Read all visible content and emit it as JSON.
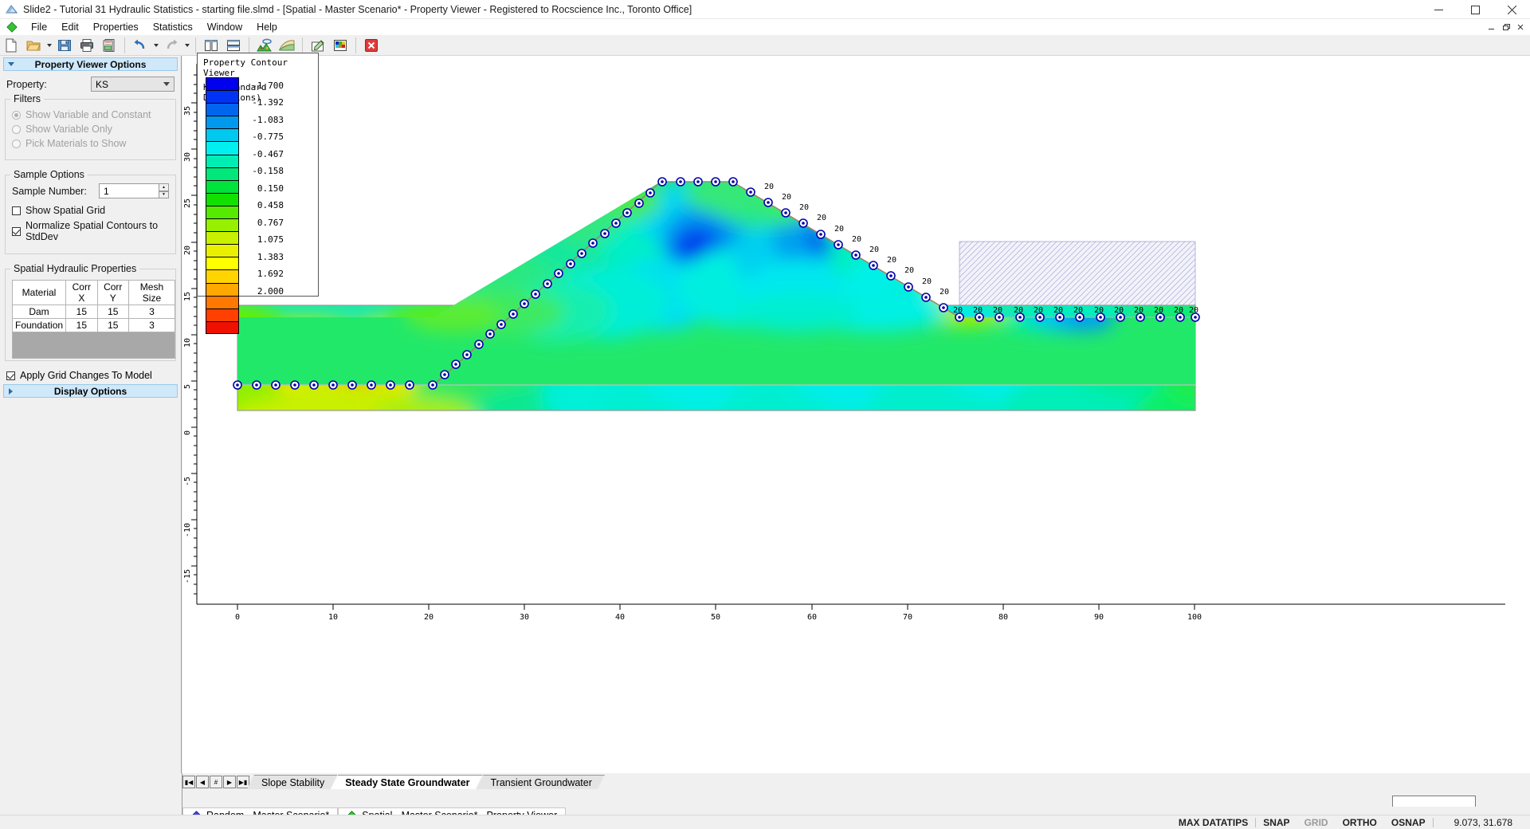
{
  "window": {
    "title": "Slide2 - Tutorial 31 Hydraulic Statistics - starting file.slmd - [Spatial - Master Scenario* - Property Viewer - Registered to Rocscience Inc., Toronto Office]",
    "minimize": "minimize-button",
    "maximize": "maximize-button",
    "close": "close-button"
  },
  "menu": {
    "items": [
      "File",
      "Edit",
      "Properties",
      "Statistics",
      "Window",
      "Help"
    ]
  },
  "toolbar": {
    "items": [
      {
        "name": "new-file-icon",
        "glyph": "new"
      },
      {
        "name": "open-file-icon",
        "glyph": "open"
      },
      {
        "name": "open-dropdown-icon",
        "glyph": "caret"
      },
      {
        "name": "save-icon",
        "glyph": "save"
      },
      {
        "name": "print-icon",
        "glyph": "print"
      },
      {
        "name": "print-preview-icon",
        "glyph": "preview"
      },
      {
        "name": "undo-icon",
        "glyph": "undo"
      },
      {
        "name": "undo-dropdown-icon",
        "glyph": "caret"
      },
      {
        "name": "redo-icon",
        "glyph": "redo"
      },
      {
        "name": "redo-dropdown-icon",
        "glyph": "caret"
      },
      {
        "name": "tile-vertical-icon",
        "glyph": "tilev"
      },
      {
        "name": "tile-horizontal-icon",
        "glyph": "tileh"
      },
      {
        "name": "material-statistics-icon",
        "glyph": "matstats"
      },
      {
        "name": "spatial-variability-icon",
        "glyph": "spatial"
      },
      {
        "name": "edit-properties-icon",
        "glyph": "editprop"
      },
      {
        "name": "property-viewer-icon",
        "glyph": "propviewer"
      },
      {
        "name": "close-view-icon",
        "glyph": "closeview"
      }
    ]
  },
  "left_panel": {
    "header": "Property Viewer Options",
    "property_label": "Property:",
    "property_value": "KS",
    "filters": {
      "title": "Filters",
      "options": [
        {
          "label": "Show Variable and Constant",
          "selected": true
        },
        {
          "label": "Show Variable Only",
          "selected": false
        },
        {
          "label": "Pick Materials to Show",
          "selected": false
        }
      ]
    },
    "sample_options": {
      "title": "Sample Options",
      "sample_number_label": "Sample Number:",
      "sample_number_value": "1",
      "checkboxes": [
        {
          "label": "Show Spatial Grid",
          "checked": false
        },
        {
          "label": "Normalize Spatial Contours to StdDev",
          "checked": true
        }
      ]
    },
    "spatial_props": {
      "title": "Spatial Hydraulic Properties",
      "columns": [
        "Material",
        "Corr X",
        "Corr Y",
        "Mesh Size"
      ],
      "rows": [
        [
          "Dam",
          "15",
          "15",
          "3"
        ],
        [
          "Foundation",
          "15",
          "15",
          "3"
        ]
      ]
    },
    "apply_grid": {
      "label": "Apply Grid Changes To Model",
      "checked": true
    },
    "display_options": "Display Options"
  },
  "legend": {
    "title_line1": "Property Contour Viewer",
    "title_line2": "KS (Standard Deviations)",
    "labels": [
      "-1.700",
      "-1.392",
      "-1.083",
      "-0.775",
      "-0.467",
      "-0.158",
      "0.150",
      "0.458",
      "0.767",
      "1.075",
      "1.383",
      "1.692",
      "2.000"
    ],
    "colors": [
      "#0000ee",
      "#0033f5",
      "#0066ee",
      "#0099ee",
      "#00c8ee",
      "#00f0f0",
      "#00eeb4",
      "#00e87a",
      "#00e23c",
      "#11e000",
      "#55ea00",
      "#96f000",
      "#c8f000",
      "#e8f000",
      "#ffff00",
      "#ffd400",
      "#ffa800",
      "#ff7800",
      "#ff4000",
      "#f01000"
    ]
  },
  "chart_data": {
    "type": "heatmap",
    "title": "Property Contour Viewer - KS (Standard Deviations)",
    "xlabel": "",
    "ylabel": "",
    "xlim": [
      -2,
      104
    ],
    "ylim": [
      -18,
      38
    ],
    "x_ticks": [
      0,
      10,
      20,
      30,
      40,
      50,
      60,
      70,
      80,
      90,
      100
    ],
    "y_ticks": [
      35,
      30,
      25,
      20,
      15,
      10,
      5,
      0,
      -5,
      -10,
      -15
    ],
    "colorbar_range": [
      -1.7,
      2.0
    ],
    "colorbar_labels": [
      "-1.700",
      "-1.392",
      "-1.083",
      "-0.775",
      "-0.467",
      "-0.158",
      "0.150",
      "0.458",
      "0.767",
      "1.075",
      "1.383",
      "1.692",
      "2.000"
    ],
    "grid": false,
    "annotations": [
      "20"
    ],
    "notes": "Embankment dam cross-section with spatially variable hydraulic conductivity (KS) contours over dam body and foundation; boundary condition nodes along crest/slope and total head 20 markers on downstream and foundation surface."
  },
  "sheet_tabs": {
    "nav": [
      "first",
      "prev",
      "insert",
      "next",
      "last"
    ],
    "tabs": [
      {
        "label": "Slope Stability",
        "active": false
      },
      {
        "label": "Steady State Groundwater",
        "active": true
      },
      {
        "label": "Transient Groundwater",
        "active": false
      }
    ]
  },
  "doc_tabs": [
    {
      "label": "Random - Master Scenario*",
      "color": "#3c3cc8",
      "active": false
    },
    {
      "label": "Spatial - Master Scenario* - Property Viewer",
      "color": "#22c422",
      "active": true
    }
  ],
  "statusbar": {
    "items": [
      {
        "label": "MAX DATATIPS",
        "dim": false
      },
      {
        "label": "SNAP",
        "dim": false
      },
      {
        "label": "GRID",
        "dim": true
      },
      {
        "label": "ORTHO",
        "dim": false
      },
      {
        "label": "OSNAP",
        "dim": false
      }
    ],
    "coords": "9.073, 31.678"
  }
}
